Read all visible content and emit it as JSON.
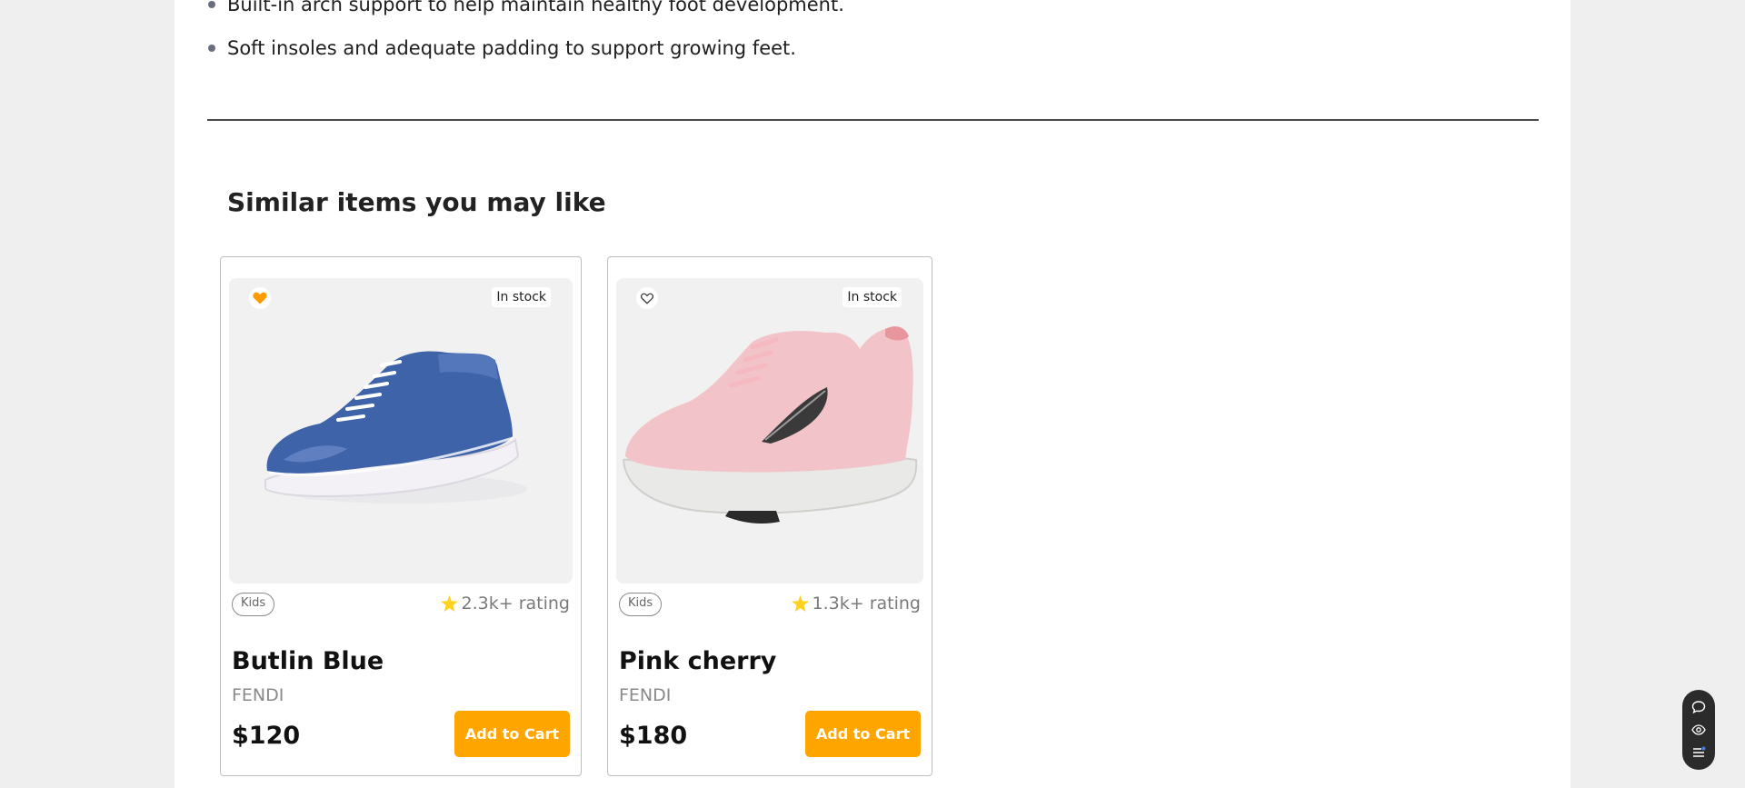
{
  "features": [
    "Built-in arch support to help maintain healthy foot development.",
    "Soft insoles and adequate padding to support growing feet."
  ],
  "section": {
    "title": "Similar items you may like"
  },
  "products": [
    {
      "name": "Butlin Blue",
      "brand": "FENDI",
      "price": "$120",
      "stock": "In stock",
      "category": "Kids",
      "rating": "2.3k+ rating",
      "wishlisted": true,
      "cart_label": "Add to Cart",
      "shoe_color": "#3f63a8"
    },
    {
      "name": "Pink cherry",
      "brand": "FENDI",
      "price": "$180",
      "stock": "In stock",
      "category": "Kids",
      "rating": "1.3k+ rating",
      "wishlisted": false,
      "cart_label": "Add to Cart",
      "shoe_color": "#f2c4c9"
    }
  ],
  "colors": {
    "accent": "#ffa500",
    "star": "#ffd21f",
    "heart_active": "#ff9a00"
  },
  "floating_actions": [
    "chat-icon",
    "eye-icon",
    "list-icon"
  ]
}
